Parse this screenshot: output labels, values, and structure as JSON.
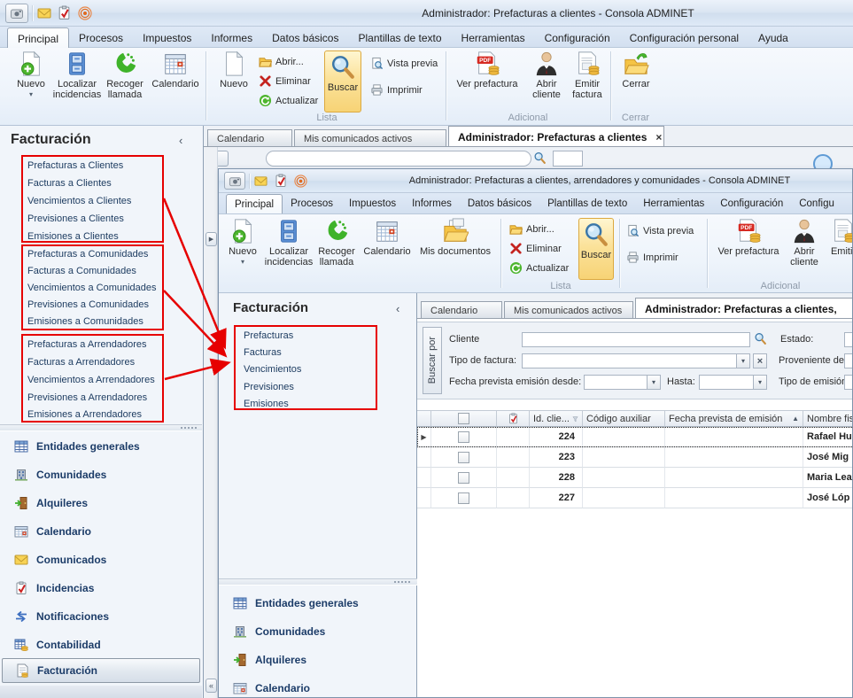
{
  "colors": {
    "annotation_red": "#e60000",
    "buscar_highlight": "#f7d376",
    "chrome_blue": "#d8e4f2"
  },
  "glyphs": {
    "dropdown": "▾",
    "close_tab": "×",
    "collapse": "‹",
    "clear": "×",
    "refresh": "↻",
    "sort_asc": "▲",
    "row_pointer": "▶",
    "expand": "▶",
    "jump_start": "«"
  },
  "outer": {
    "title": "Administrador: Prefacturas a clientes - Consola ADMINET",
    "tabs": [
      "Principal",
      "Procesos",
      "Impuestos",
      "Informes",
      "Datos básicos",
      "Plantillas de texto",
      "Herramientas",
      "Configuración",
      "Configuración personal",
      "Ayuda"
    ],
    "ribbon": {
      "nuevo_split": "Nuevo",
      "localizar": "Localizar incidencias",
      "recoger": "Recoger llamada",
      "calendario": "Calendario",
      "nuevo": "Nuevo",
      "abrir": "Abrir...",
      "eliminar": "Eliminar",
      "actualizar": "Actualizar",
      "buscar": "Buscar",
      "vista_previa": "Vista previa",
      "imprimir": "Imprimir",
      "grupo_lista": "Lista",
      "ver_prefactura": "Ver prefactura",
      "abrir_cliente": "Abrir cliente",
      "emitir_factura": "Emitir factura",
      "grupo_adicional": "Adicional",
      "cerrar": "Cerrar",
      "grupo_cerrar": "Cerrar"
    },
    "sidebar": {
      "header": "Facturación",
      "clientes": [
        "Prefacturas a Clientes",
        "Facturas a Clientes",
        "Vencimientos a Clientes",
        "Previsiones a Clientes",
        "Emisiones a Clientes"
      ],
      "comunidades": [
        "Prefacturas a Comunidades",
        "Facturas a Comunidades",
        "Vencimientos a Comunidades",
        "Previsiones a Comunidades",
        "Emisiones a Comunidades"
      ],
      "arrendadores": [
        "Prefacturas a Arrendadores",
        "Facturas a Arrendadores",
        "Vencimientos a Arrendadores",
        "Previsiones a Arrendadores",
        "Emisiones a Arrendadores"
      ],
      "nav": [
        "Entidades generales",
        "Comunidades",
        "Alquileres",
        "Calendario",
        "Comunicados",
        "Incidencias",
        "Notificaciones",
        "Contabilidad",
        "Facturación"
      ]
    },
    "doc_tabs": [
      "Calendario",
      "Mis comunicados activos",
      "Administrador: Prefacturas a clientes"
    ]
  },
  "inner": {
    "title": "Administrador: Prefacturas a clientes, arrendadores y comunidades - Consola ADMINET",
    "tabs": [
      "Principal",
      "Procesos",
      "Impuestos",
      "Informes",
      "Datos básicos",
      "Plantillas de texto",
      "Herramientas",
      "Configuración",
      "Configu"
    ],
    "ribbon": {
      "nuevo_split": "Nuevo",
      "localizar": "Localizar incidencias",
      "recoger": "Recoger llamada",
      "calendario": "Calendario",
      "mis_documentos": "Mis documentos",
      "abrir": "Abrir...",
      "eliminar": "Eliminar",
      "actualizar": "Actualizar",
      "buscar": "Buscar",
      "vista_previa": "Vista previa",
      "imprimir": "Imprimir",
      "grupo_lista": "Lista",
      "ver_prefactura": "Ver prefactura",
      "abrir_cliente": "Abrir cliente",
      "emitir": "Emitir",
      "grupo_adicional": "Adicional"
    },
    "sidebar": {
      "header": "Facturación",
      "items": [
        "Prefacturas",
        "Facturas",
        "Vencimientos",
        "Previsiones",
        "Emisiones"
      ],
      "nav": [
        "Entidades generales",
        "Comunidades",
        "Alquileres",
        "Calendario"
      ]
    },
    "doc_tabs": [
      "Calendario",
      "Mis comunicados activos",
      "Administrador: Prefacturas a clientes,"
    ],
    "search": {
      "panel": "Buscar por",
      "cliente": "Cliente",
      "tipo_factura": "Tipo de factura:",
      "fecha_desde": "Fecha prevista emisión desde:",
      "hasta": "Hasta:",
      "estado": "Estado:",
      "proveniente": "Proveniente de:",
      "tipo_emision": "Tipo de emisión:"
    },
    "table": {
      "columns": {
        "id": "Id. clie...",
        "codigo": "Código auxiliar",
        "fecha": "Fecha prevista de emisión",
        "nombre": "Nombre fis"
      },
      "rows": [
        {
          "id": "224",
          "nombre": "Rafael Hu"
        },
        {
          "id": "223",
          "nombre": "José Mig"
        },
        {
          "id": "228",
          "nombre": "Maria Lea"
        },
        {
          "id": "227",
          "nombre": "José Lóp"
        }
      ]
    }
  }
}
